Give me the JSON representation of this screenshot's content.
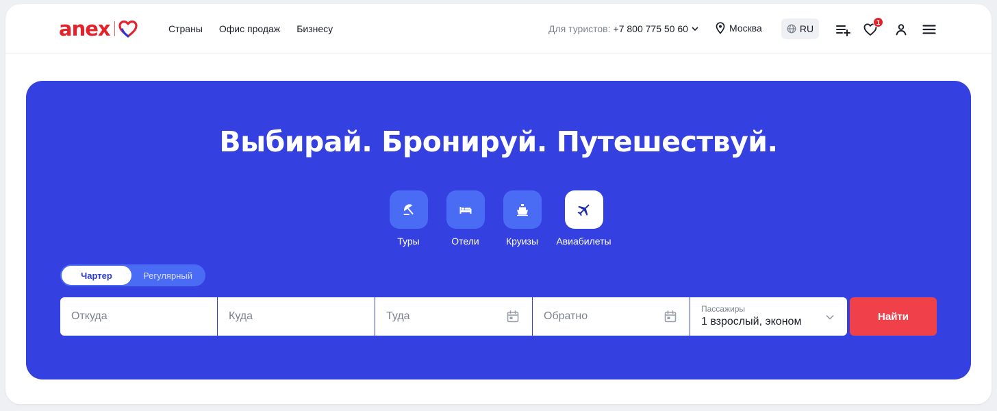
{
  "brand": {
    "logo_text": "anex",
    "accent": "#e3232b",
    "hero_bg": "#3540e0"
  },
  "nav": {
    "items": [
      "Страны",
      "Офис продаж",
      "Бизнесу"
    ]
  },
  "header": {
    "phone_label": "Для туристов:",
    "phone_number": "+7 800 775 50 60",
    "city": "Москва",
    "lang": "RU",
    "favorites_count": "1",
    "icons": [
      "compare-list-icon",
      "heart-icon",
      "user-icon",
      "menu-icon"
    ]
  },
  "hero": {
    "headline": "Выбирай. Бронируй. Путешествуй.",
    "categories": [
      {
        "label": "Туры",
        "icon": "beach-umbrella-icon"
      },
      {
        "label": "Отели",
        "icon": "bed-icon"
      },
      {
        "label": "Круизы",
        "icon": "ship-icon"
      },
      {
        "label": "Авиабилеты",
        "icon": "airplane-icon",
        "active": true
      }
    ],
    "toggle": {
      "charter": "Чартер",
      "regular": "Регулярный",
      "selected": "Чартер"
    }
  },
  "search": {
    "from_placeholder": "Откуда",
    "to_placeholder": "Куда",
    "depart_placeholder": "Туда",
    "return_placeholder": "Обратно",
    "passengers_label": "Пассажиры",
    "passengers_value": "1 взрослый, эконом",
    "submit_label": "Найти"
  }
}
